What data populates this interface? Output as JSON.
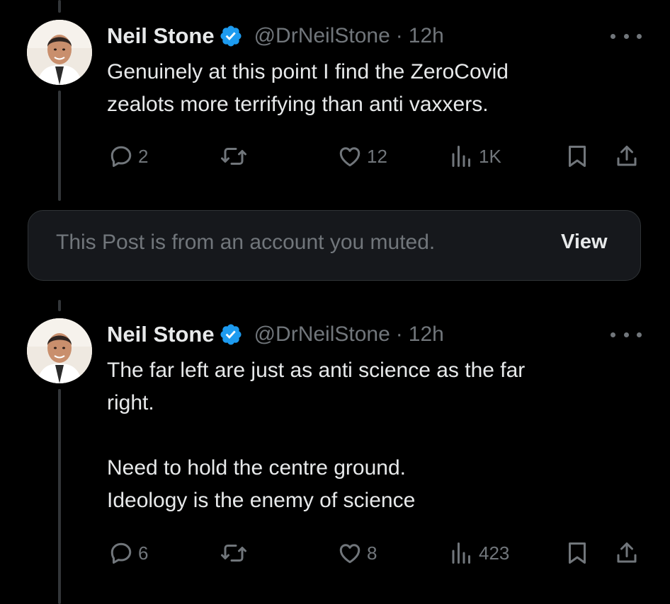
{
  "colors": {
    "background": "#000000",
    "text_primary": "#e7e9ea",
    "text_secondary": "#71767b",
    "verified_badge": "#1d9bf0",
    "muted_box_bg": "#16181c"
  },
  "tweets": [
    {
      "author_name": "Neil Stone",
      "verified": true,
      "handle": "@DrNeilStone",
      "separator": "·",
      "time": "12h",
      "text_lines": [
        "Genuinely at this point I find the ZeroCovid",
        "zealots more terrifying than anti vaxxers."
      ],
      "replies": "2",
      "retweets": "",
      "likes": "12",
      "views": "1K",
      "icons": [
        "reply-icon",
        "retweet-icon",
        "like-icon",
        "views-icon",
        "bookmark-icon",
        "share-icon",
        "more-icon"
      ]
    },
    {
      "author_name": "Neil Stone",
      "verified": true,
      "handle": "@DrNeilStone",
      "separator": "·",
      "time": "12h",
      "text_lines": [
        "The far left are just as anti science as the far",
        "right.",
        "",
        "Need to hold the centre ground.",
        "Ideology is the enemy of science"
      ],
      "replies": "6",
      "retweets": "",
      "likes": "8",
      "views": "423",
      "icons": [
        "reply-icon",
        "retweet-icon",
        "like-icon",
        "views-icon",
        "bookmark-icon",
        "share-icon",
        "more-icon"
      ]
    }
  ],
  "muted_notice": {
    "text": "This Post is from an account you muted.",
    "button_label": "View"
  }
}
